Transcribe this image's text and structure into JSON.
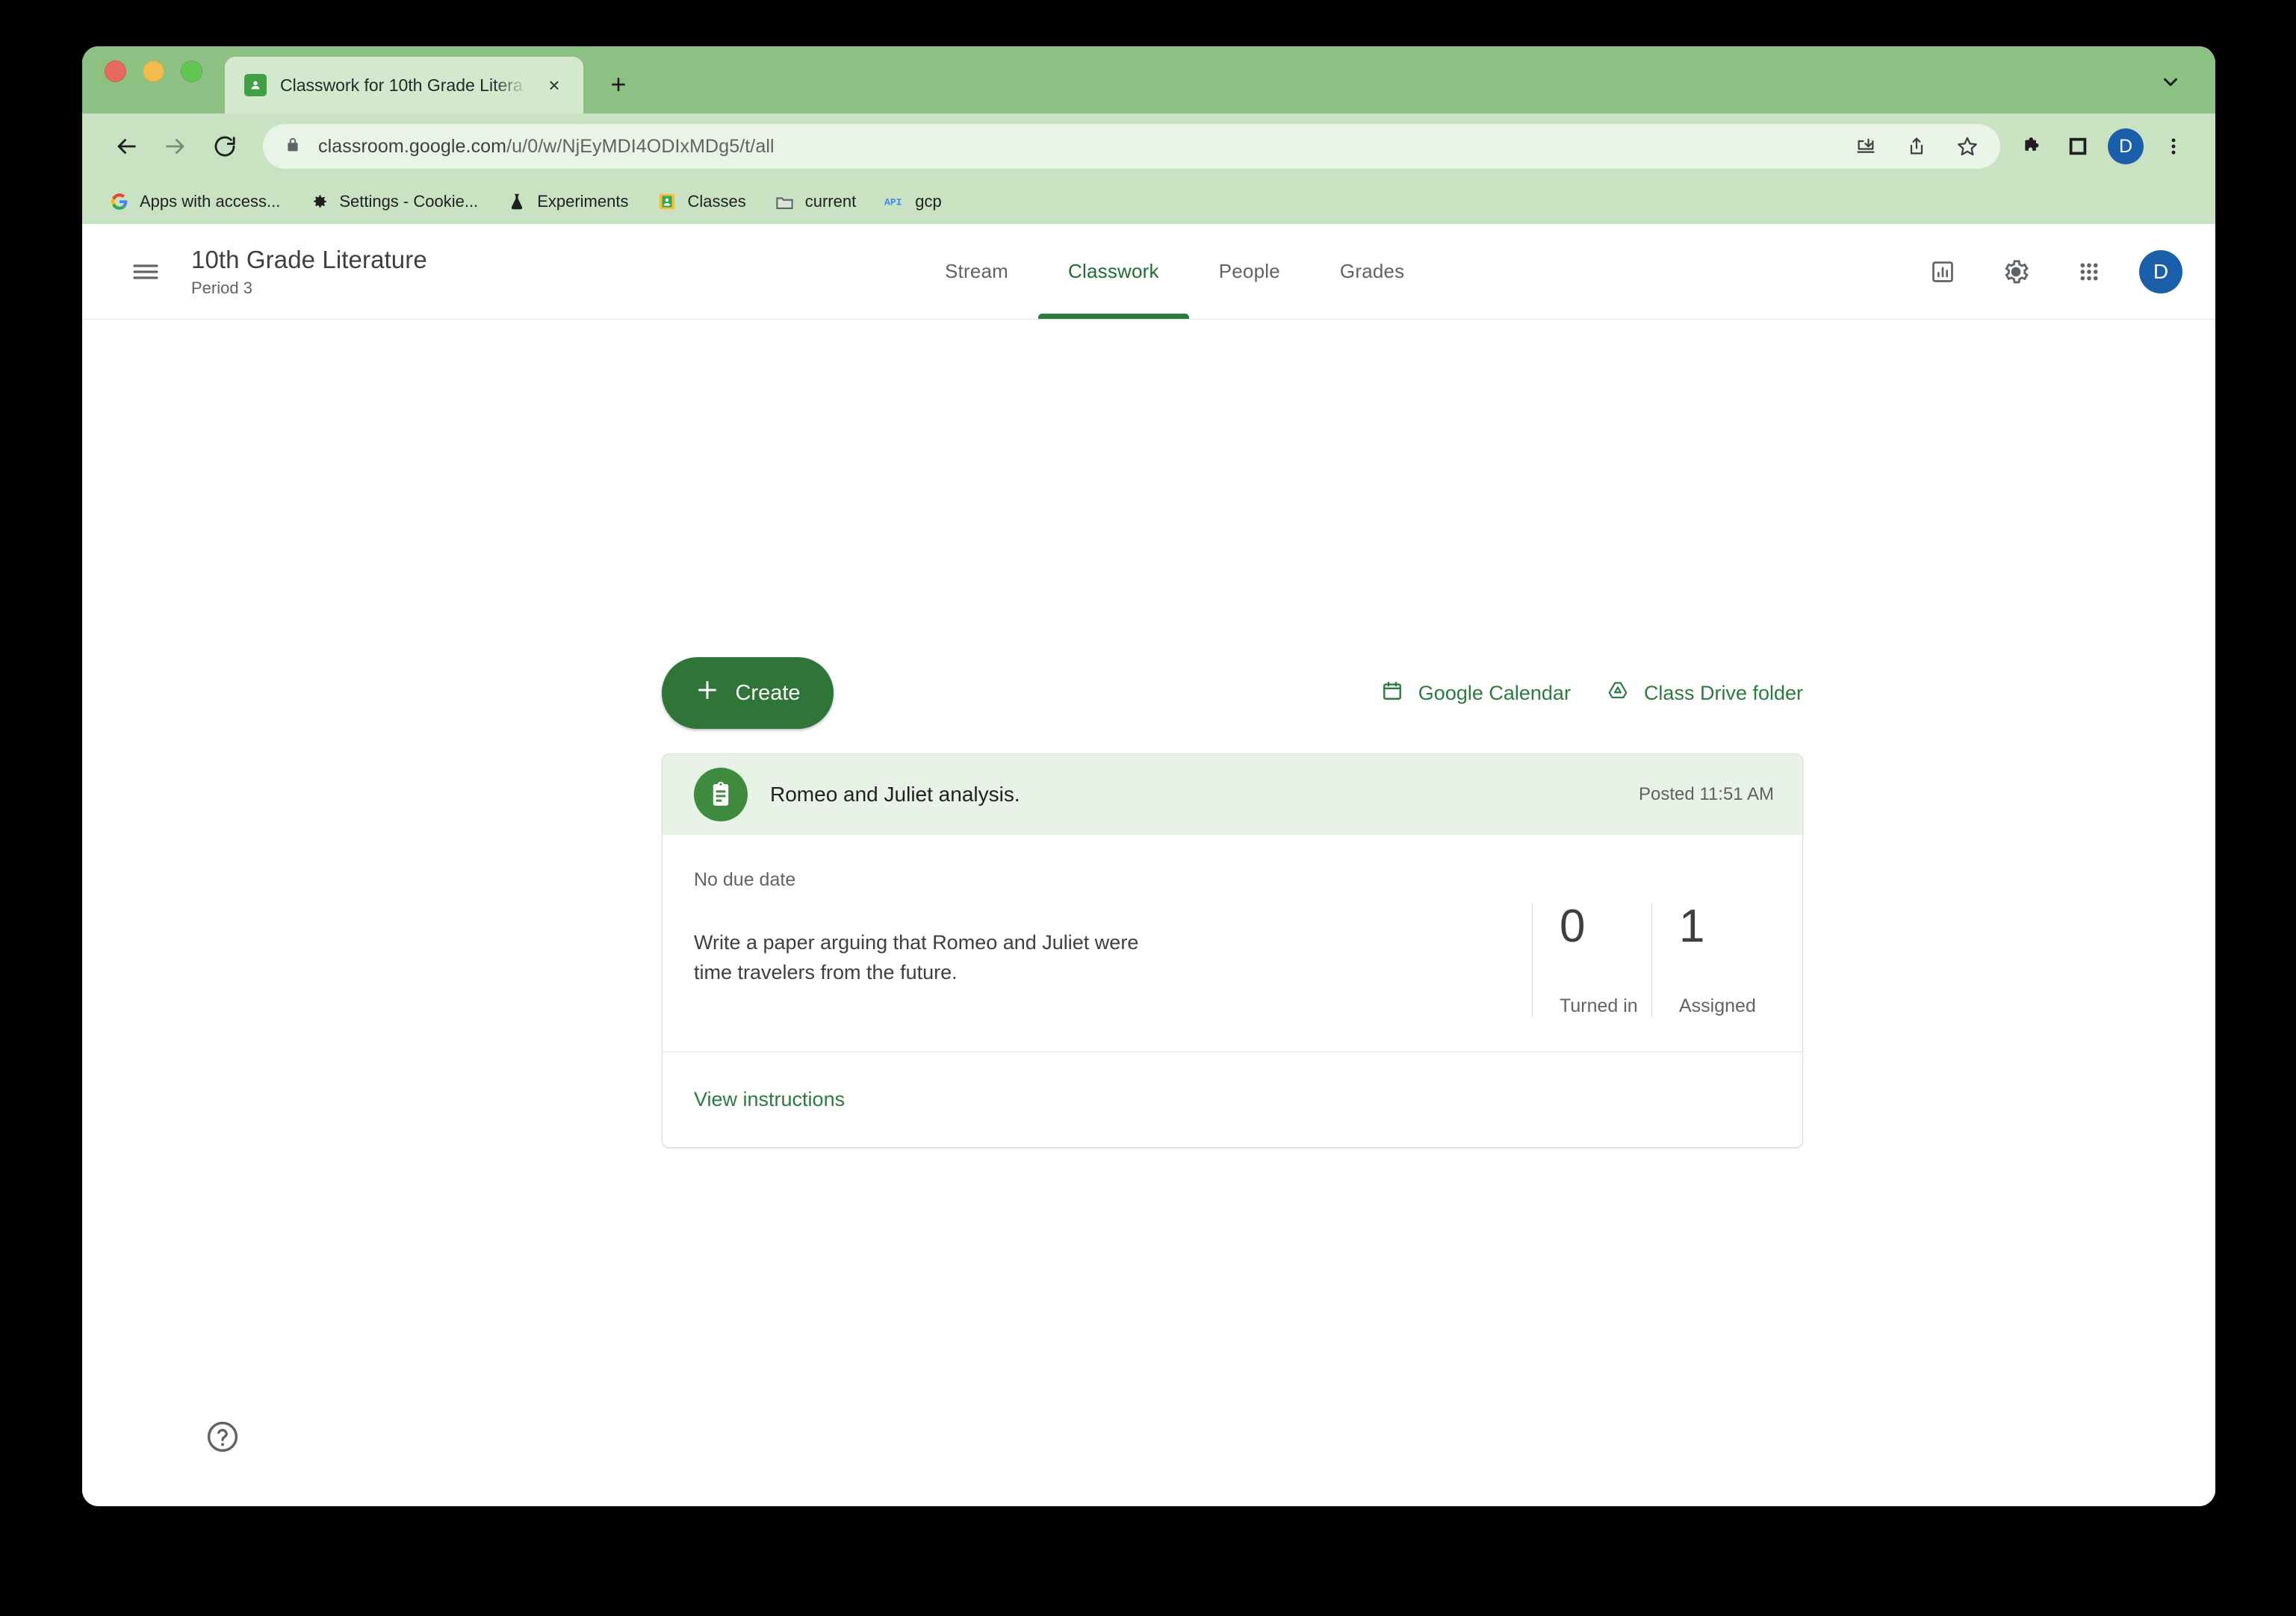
{
  "browser": {
    "tab": {
      "title": "Classwork for 10th Grade Litera",
      "favicon": "classroom-favicon",
      "close_label": "×"
    },
    "new_tab_label": "+",
    "url_host": "classroom.google.com",
    "url_path": "/u/0/w/NjEyMDI4ODIxMDg5/t/all",
    "profile_initial": "D",
    "bookmarks": [
      {
        "label": "Apps with access...",
        "icon": "google-g-icon"
      },
      {
        "label": "Settings - Cookie...",
        "icon": "gear-icon"
      },
      {
        "label": "Experiments",
        "icon": "flask-icon"
      },
      {
        "label": "Classes",
        "icon": "classroom-icon"
      },
      {
        "label": "current",
        "icon": "folder-icon"
      },
      {
        "label": "gcp",
        "icon": "api-icon"
      }
    ]
  },
  "classroom": {
    "class_title": "10th Grade Literature",
    "class_section": "Period 3",
    "tabs": [
      {
        "label": "Stream",
        "active": false
      },
      {
        "label": "Classwork",
        "active": true
      },
      {
        "label": "People",
        "active": false
      },
      {
        "label": "Grades",
        "active": false
      }
    ],
    "account_initial": "D",
    "create_button": "Create",
    "quick_links": [
      {
        "label": "Google Calendar",
        "icon": "calendar-icon"
      },
      {
        "label": "Class Drive folder",
        "icon": "drive-icon"
      }
    ],
    "assignment": {
      "title": "Romeo and Juliet analysis.",
      "posted": "Posted 11:51 AM",
      "due": "No due date",
      "description": "Write a paper arguing that Romeo and Juliet were time travelers from the future.",
      "stats": [
        {
          "value": "0",
          "label": "Turned in"
        },
        {
          "value": "1",
          "label": "Assigned"
        }
      ],
      "view_instructions": "View instructions"
    }
  },
  "colors": {
    "brand_green": "#2c7a3f",
    "create_green": "#2e7537",
    "chrome_green": "#8cc183",
    "toolbar_green": "#c9e2c1",
    "card_header": "#e8f2e6",
    "avatar_blue": "#1b5faa"
  }
}
